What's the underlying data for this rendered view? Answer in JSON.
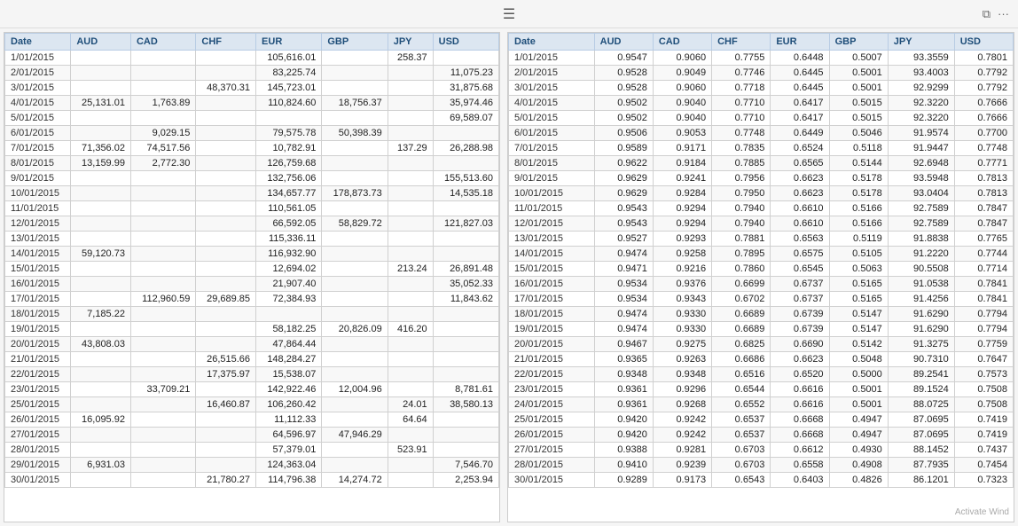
{
  "window": {
    "title": ""
  },
  "table1": {
    "columns": [
      "Date",
      "AUD",
      "CAD",
      "CHF",
      "EUR",
      "GBP",
      "JPY",
      "USD"
    ],
    "rows": [
      [
        "1/01/2015",
        "",
        "",
        "",
        "105,616.01",
        "",
        "258.37",
        ""
      ],
      [
        "2/01/2015",
        "",
        "",
        "",
        "83,225.74",
        "",
        "",
        "11,075.23"
      ],
      [
        "3/01/2015",
        "",
        "",
        "48,370.31",
        "145,723.01",
        "",
        "",
        "31,875.68"
      ],
      [
        "4/01/2015",
        "25,131.01",
        "1,763.89",
        "",
        "110,824.60",
        "18,756.37",
        "",
        "35,974.46"
      ],
      [
        "5/01/2015",
        "",
        "",
        "",
        "",
        "",
        "",
        "69,589.07"
      ],
      [
        "6/01/2015",
        "",
        "9,029.15",
        "",
        "79,575.78",
        "50,398.39",
        "",
        ""
      ],
      [
        "7/01/2015",
        "71,356.02",
        "74,517.56",
        "",
        "10,782.91",
        "",
        "137.29",
        "26,288.98"
      ],
      [
        "8/01/2015",
        "13,159.99",
        "2,772.30",
        "",
        "126,759.68",
        "",
        "",
        ""
      ],
      [
        "9/01/2015",
        "",
        "",
        "",
        "132,756.06",
        "",
        "",
        "155,513.60"
      ],
      [
        "10/01/2015",
        "",
        "",
        "",
        "134,657.77",
        "178,873.73",
        "",
        "14,535.18"
      ],
      [
        "11/01/2015",
        "",
        "",
        "",
        "110,561.05",
        "",
        "",
        ""
      ],
      [
        "12/01/2015",
        "",
        "",
        "",
        "66,592.05",
        "58,829.72",
        "",
        "121,827.03"
      ],
      [
        "13/01/2015",
        "",
        "",
        "",
        "115,336.11",
        "",
        "",
        ""
      ],
      [
        "14/01/2015",
        "59,120.73",
        "",
        "",
        "116,932.90",
        "",
        "",
        ""
      ],
      [
        "15/01/2015",
        "",
        "",
        "",
        "12,694.02",
        "",
        "213.24",
        "26,891.48"
      ],
      [
        "16/01/2015",
        "",
        "",
        "",
        "21,907.40",
        "",
        "",
        "35,052.33"
      ],
      [
        "17/01/2015",
        "",
        "112,960.59",
        "29,689.85",
        "72,384.93",
        "",
        "",
        "11,843.62"
      ],
      [
        "18/01/2015",
        "7,185.22",
        "",
        "",
        "",
        "",
        "",
        ""
      ],
      [
        "19/01/2015",
        "",
        "",
        "",
        "58,182.25",
        "20,826.09",
        "416.20",
        ""
      ],
      [
        "20/01/2015",
        "43,808.03",
        "",
        "",
        "47,864.44",
        "",
        "",
        ""
      ],
      [
        "21/01/2015",
        "",
        "",
        "26,515.66",
        "148,284.27",
        "",
        "",
        ""
      ],
      [
        "22/01/2015",
        "",
        "",
        "17,375.97",
        "15,538.07",
        "",
        "",
        ""
      ],
      [
        "23/01/2015",
        "",
        "33,709.21",
        "",
        "142,922.46",
        "12,004.96",
        "",
        "8,781.61"
      ],
      [
        "25/01/2015",
        "",
        "",
        "16,460.87",
        "106,260.42",
        "",
        "24.01",
        "38,580.13"
      ],
      [
        "26/01/2015",
        "16,095.92",
        "",
        "",
        "11,112.33",
        "",
        "64.64",
        ""
      ],
      [
        "27/01/2015",
        "",
        "",
        "",
        "64,596.97",
        "47,946.29",
        "",
        ""
      ],
      [
        "28/01/2015",
        "",
        "",
        "",
        "57,379.01",
        "",
        "523.91",
        ""
      ],
      [
        "29/01/2015",
        "6,931.03",
        "",
        "",
        "124,363.04",
        "",
        "",
        "7,546.70"
      ],
      [
        "30/01/2015",
        "",
        "",
        "21,780.27",
        "114,796.38",
        "14,274.72",
        "",
        "2,253.94"
      ]
    ]
  },
  "table2": {
    "columns": [
      "Date",
      "AUD",
      "CAD",
      "CHF",
      "EUR",
      "GBP",
      "JPY",
      "USD"
    ],
    "rows": [
      [
        "1/01/2015",
        "0.9547",
        "0.9060",
        "0.7755",
        "0.6448",
        "0.5007",
        "93.3559",
        "0.7801"
      ],
      [
        "2/01/2015",
        "0.9528",
        "0.9049",
        "0.7746",
        "0.6445",
        "0.5001",
        "93.4003",
        "0.7792"
      ],
      [
        "3/01/2015",
        "0.9528",
        "0.9060",
        "0.7718",
        "0.6445",
        "0.5001",
        "92.9299",
        "0.7792"
      ],
      [
        "4/01/2015",
        "0.9502",
        "0.9040",
        "0.7710",
        "0.6417",
        "0.5015",
        "92.3220",
        "0.7666"
      ],
      [
        "5/01/2015",
        "0.9502",
        "0.9040",
        "0.7710",
        "0.6417",
        "0.5015",
        "92.3220",
        "0.7666"
      ],
      [
        "6/01/2015",
        "0.9506",
        "0.9053",
        "0.7748",
        "0.6449",
        "0.5046",
        "91.9574",
        "0.7700"
      ],
      [
        "7/01/2015",
        "0.9589",
        "0.9171",
        "0.7835",
        "0.6524",
        "0.5118",
        "91.9447",
        "0.7748"
      ],
      [
        "8/01/2015",
        "0.9622",
        "0.9184",
        "0.7885",
        "0.6565",
        "0.5144",
        "92.6948",
        "0.7771"
      ],
      [
        "9/01/2015",
        "0.9629",
        "0.9241",
        "0.7956",
        "0.6623",
        "0.5178",
        "93.5948",
        "0.7813"
      ],
      [
        "10/01/2015",
        "0.9629",
        "0.9284",
        "0.7950",
        "0.6623",
        "0.5178",
        "93.0404",
        "0.7813"
      ],
      [
        "11/01/2015",
        "0.9543",
        "0.9294",
        "0.7940",
        "0.6610",
        "0.5166",
        "92.7589",
        "0.7847"
      ],
      [
        "12/01/2015",
        "0.9543",
        "0.9294",
        "0.7940",
        "0.6610",
        "0.5166",
        "92.7589",
        "0.7847"
      ],
      [
        "13/01/2015",
        "0.9527",
        "0.9293",
        "0.7881",
        "0.6563",
        "0.5119",
        "91.8838",
        "0.7765"
      ],
      [
        "14/01/2015",
        "0.9474",
        "0.9258",
        "0.7895",
        "0.6575",
        "0.5105",
        "91.2220",
        "0.7744"
      ],
      [
        "15/01/2015",
        "0.9471",
        "0.9216",
        "0.7860",
        "0.6545",
        "0.5063",
        "90.5508",
        "0.7714"
      ],
      [
        "16/01/2015",
        "0.9534",
        "0.9376",
        "0.6699",
        "0.6737",
        "0.5165",
        "91.0538",
        "0.7841"
      ],
      [
        "17/01/2015",
        "0.9534",
        "0.9343",
        "0.6702",
        "0.6737",
        "0.5165",
        "91.4256",
        "0.7841"
      ],
      [
        "18/01/2015",
        "0.9474",
        "0.9330",
        "0.6689",
        "0.6739",
        "0.5147",
        "91.6290",
        "0.7794"
      ],
      [
        "19/01/2015",
        "0.9474",
        "0.9330",
        "0.6689",
        "0.6739",
        "0.5147",
        "91.6290",
        "0.7794"
      ],
      [
        "20/01/2015",
        "0.9467",
        "0.9275",
        "0.6825",
        "0.6690",
        "0.5142",
        "91.3275",
        "0.7759"
      ],
      [
        "21/01/2015",
        "0.9365",
        "0.9263",
        "0.6686",
        "0.6623",
        "0.5048",
        "90.7310",
        "0.7647"
      ],
      [
        "22/01/2015",
        "0.9348",
        "0.9348",
        "0.6516",
        "0.6520",
        "0.5000",
        "89.2541",
        "0.7573"
      ],
      [
        "23/01/2015",
        "0.9361",
        "0.9296",
        "0.6544",
        "0.6616",
        "0.5001",
        "89.1524",
        "0.7508"
      ],
      [
        "24/01/2015",
        "0.9361",
        "0.9268",
        "0.6552",
        "0.6616",
        "0.5001",
        "88.0725",
        "0.7508"
      ],
      [
        "25/01/2015",
        "0.9420",
        "0.9242",
        "0.6537",
        "0.6668",
        "0.4947",
        "87.0695",
        "0.7419"
      ],
      [
        "26/01/2015",
        "0.9420",
        "0.9242",
        "0.6537",
        "0.6668",
        "0.4947",
        "87.0695",
        "0.7419"
      ],
      [
        "27/01/2015",
        "0.9388",
        "0.9281",
        "0.6703",
        "0.6612",
        "0.4930",
        "88.1452",
        "0.7437"
      ],
      [
        "28/01/2015",
        "0.9410",
        "0.9239",
        "0.6703",
        "0.6558",
        "0.4908",
        "87.7935",
        "0.7454"
      ],
      [
        "30/01/2015",
        "0.9289",
        "0.9173",
        "0.6543",
        "0.6403",
        "0.4826",
        "86.1201",
        "0.7323"
      ]
    ]
  },
  "watermark": "Activate Wind"
}
